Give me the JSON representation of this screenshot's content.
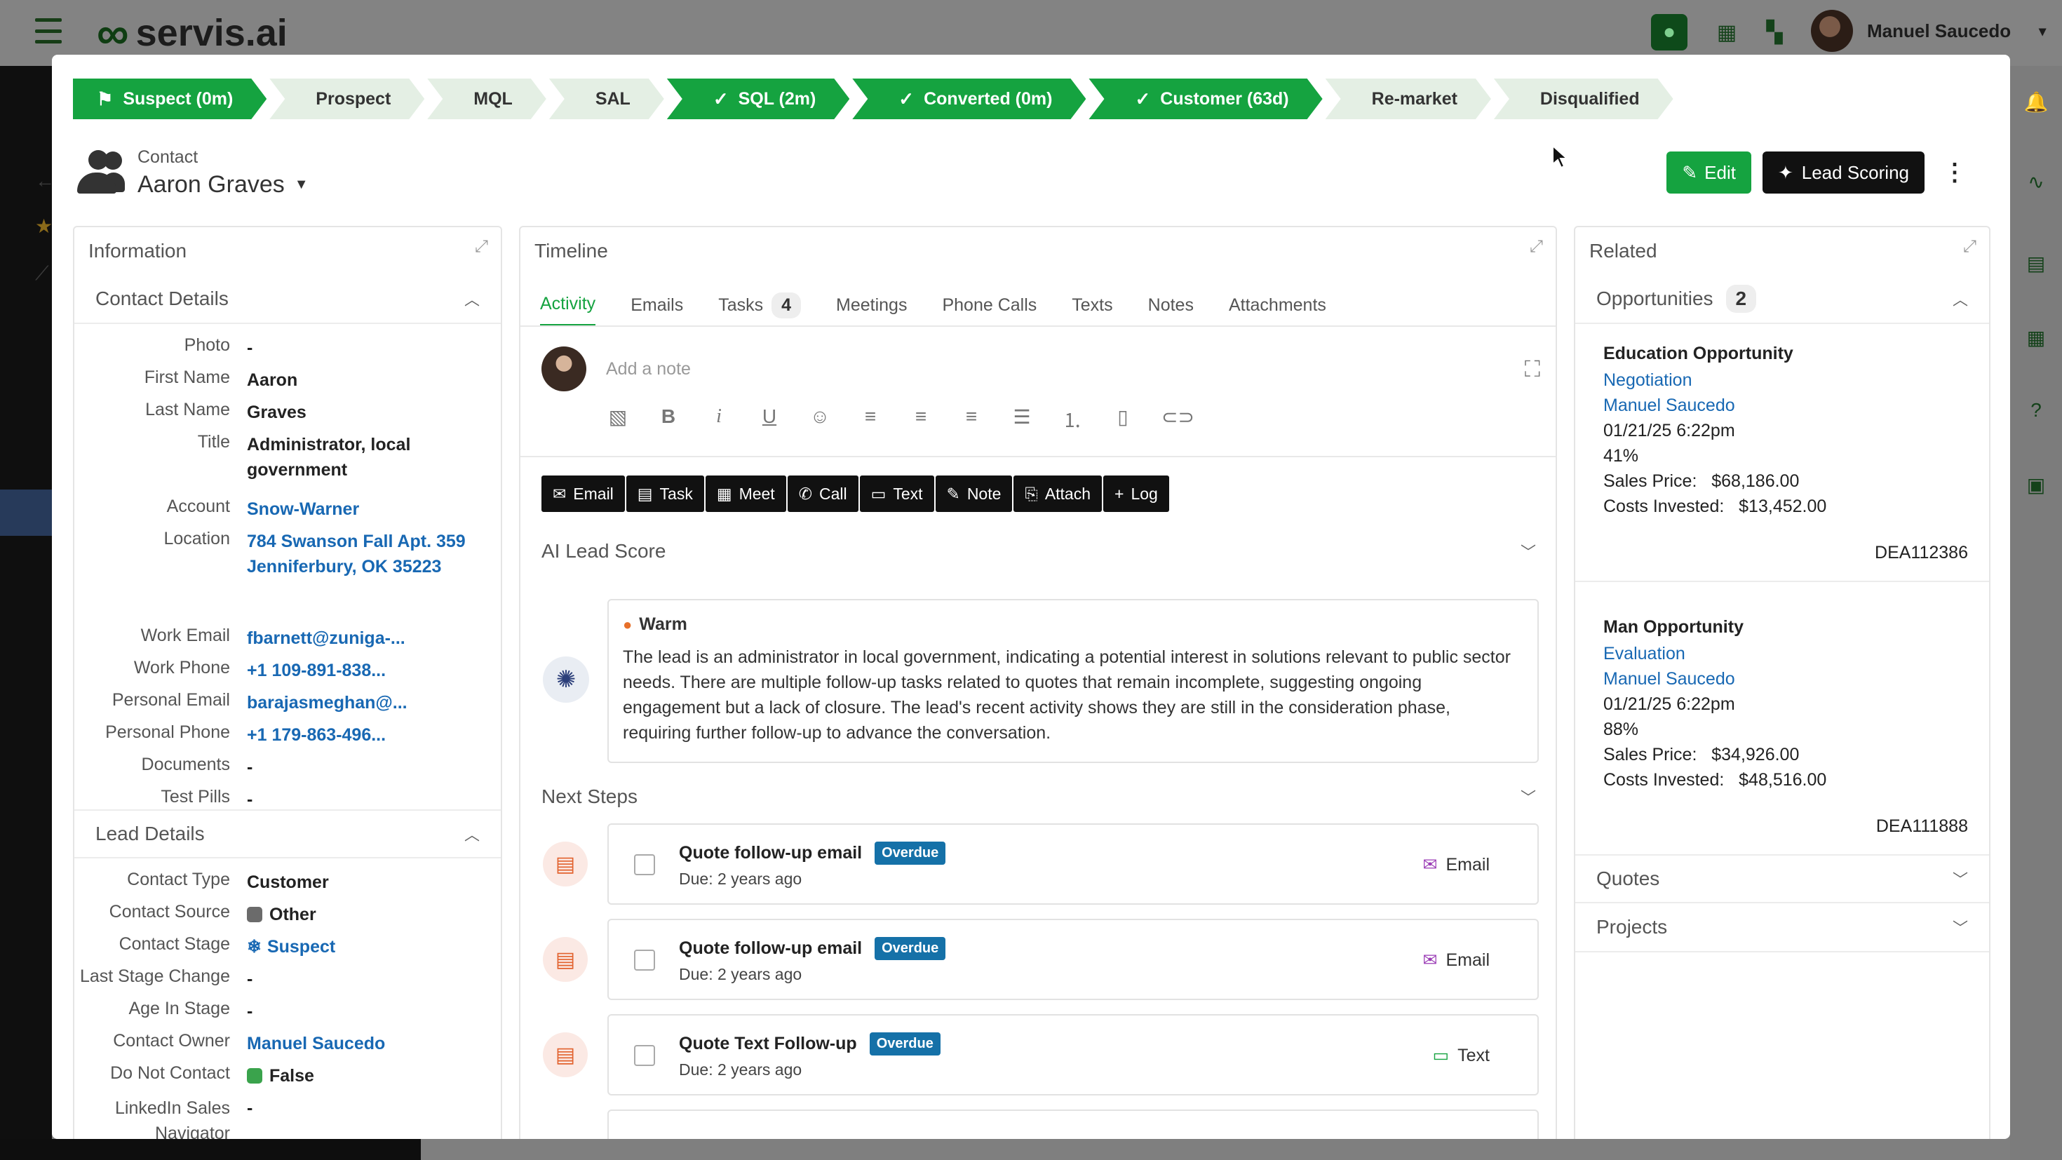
{
  "app": {
    "logo": "servis.ai",
    "user_name": "Manuel Saucedo"
  },
  "stages": [
    {
      "label": "Suspect (0m)",
      "state": "done",
      "icon": "flag"
    },
    {
      "label": "Prospect",
      "state": "pending"
    },
    {
      "label": "MQL",
      "state": "pending"
    },
    {
      "label": "SAL",
      "state": "pending"
    },
    {
      "label": "SQL (2m)",
      "state": "done",
      "icon": "check"
    },
    {
      "label": "Converted (0m)",
      "state": "done",
      "icon": "check"
    },
    {
      "label": "Customer (63d)",
      "state": "done",
      "icon": "check"
    },
    {
      "label": "Re-market",
      "state": "pending"
    },
    {
      "label": "Disqualified",
      "state": "pending"
    }
  ],
  "header": {
    "record_type": "Contact",
    "name": "Aaron Graves",
    "edit_label": "Edit",
    "lead_scoring_label": "Lead Scoring"
  },
  "info": {
    "title": "Information",
    "contact_details_title": "Contact Details",
    "contact_fields": [
      {
        "label": "Photo",
        "value": "-"
      },
      {
        "label": "First Name",
        "value": "Aaron"
      },
      {
        "label": "Last Name",
        "value": "Graves"
      },
      {
        "label": "Title",
        "value": "Administrator, local government"
      },
      {
        "label": "Account",
        "value": "Snow-Warner"
      },
      {
        "label": "Location",
        "value": "784 Swanson Fall Apt. 359 Jenniferbury, OK 35223"
      },
      {
        "label": "Work Email",
        "value": "fbarnett@zuniga-..."
      },
      {
        "label": "Work Phone",
        "value": "+1 109-891-838..."
      },
      {
        "label": "Personal Email",
        "value": "barajasmeghan@..."
      },
      {
        "label": "Personal Phone",
        "value": "+1 179-863-496..."
      },
      {
        "label": "Documents",
        "value": "-"
      },
      {
        "label": "Test Pills",
        "value": "-"
      }
    ],
    "lead_details_title": "Lead Details",
    "lead_fields": [
      {
        "label": "Contact Type",
        "value": "Customer"
      },
      {
        "label": "Contact Source",
        "value": "Other"
      },
      {
        "label": "Contact Stage",
        "value": "Suspect"
      },
      {
        "label": "Last Stage Change",
        "value": "-"
      },
      {
        "label": "Age In Stage",
        "value": "-"
      },
      {
        "label": "Contact Owner",
        "value": "Manuel Saucedo"
      },
      {
        "label": "Do Not Contact",
        "value": "False"
      },
      {
        "label": "LinkedIn Sales Navigator",
        "value": "-"
      }
    ]
  },
  "timeline": {
    "title": "Timeline",
    "tabs": [
      {
        "label": "Activity",
        "active": true
      },
      {
        "label": "Emails"
      },
      {
        "label": "Tasks",
        "count": "4"
      },
      {
        "label": "Meetings"
      },
      {
        "label": "Phone Calls"
      },
      {
        "label": "Texts"
      },
      {
        "label": "Notes"
      },
      {
        "label": "Attachments"
      }
    ],
    "note_placeholder": "Add a note",
    "actions": [
      "Email",
      "Task",
      "Meet",
      "Call",
      "Text",
      "Note",
      "Attach",
      "Log"
    ],
    "ai_lead_score_title": "AI Lead Score",
    "score_label": "Warm",
    "score_text": "The lead is an administrator in local government, indicating a potential interest in solutions relevant to public sector needs. There are multiple follow-up tasks related to quotes that remain incomplete, suggesting ongoing engagement but a lack of closure. The lead's recent activity shows they are still in the consideration phase, requiring further follow-up to advance the conversation.",
    "next_steps_title": "Next Steps",
    "next_steps": [
      {
        "title": "Quote follow-up email",
        "badge": "Overdue",
        "due": "Due: 2 years ago",
        "type": "Email"
      },
      {
        "title": "Quote follow-up email",
        "badge": "Overdue",
        "due": "Due: 2 years ago",
        "type": "Email"
      },
      {
        "title": "Quote Text Follow-up",
        "badge": "Overdue",
        "due": "Due: 2 years ago",
        "type": "Text"
      }
    ]
  },
  "related": {
    "title": "Related",
    "opportunities_title": "Opportunities",
    "opportunities_count": "2",
    "opportunities": [
      {
        "name": "Education Opportunity",
        "stage": "Negotiation",
        "owner": "Manuel Saucedo",
        "date": "01/21/25 6:22pm",
        "probability": "41%",
        "sales_price_label": "Sales Price:",
        "sales_price": "$68,186.00",
        "costs_label": "Costs Invested:",
        "costs": "$13,452.00",
        "code": "DEA112386"
      },
      {
        "name": "Man Opportunity",
        "stage": "Evaluation",
        "owner": "Manuel Saucedo",
        "date": "01/21/25 6:22pm",
        "probability": "88%",
        "sales_price_label": "Sales Price:",
        "sales_price": "$34,926.00",
        "costs_label": "Costs Invested:",
        "costs": "$48,516.00",
        "code": "DEA111888"
      }
    ],
    "quotes_title": "Quotes",
    "projects_title": "Projects"
  },
  "colors": {
    "brand_green": "#15a340",
    "link_blue": "#1868b3",
    "overdue_blue": "#1571a8",
    "other_gray": "#6b6b6b",
    "false_green": "#3aa34c"
  }
}
